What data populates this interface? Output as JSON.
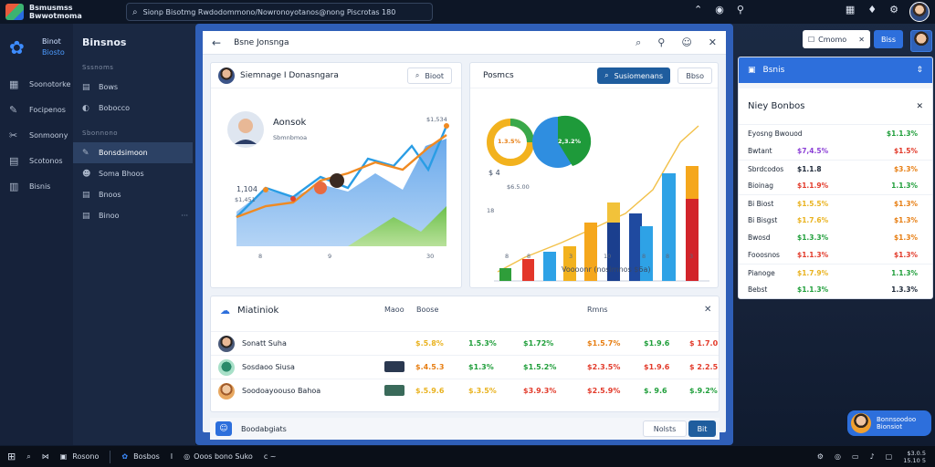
{
  "topbar": {
    "app_title_1": "Bsmusmss",
    "app_title_2": "Bwwotmoma",
    "search_text": "Sionp Bisotmg Rwdodommono/Nowronoyotanos@nong Piscrotas 180",
    "icons": [
      "trend-icon",
      "sync-icon",
      "person-search-icon",
      "grid-icon",
      "shield-icon",
      "settings-icon"
    ]
  },
  "sidebar": {
    "brand_line_1": "Binot",
    "brand_line_2": "Biosto",
    "items": [
      {
        "label": "Soonotorke",
        "icon": "grid-icon"
      },
      {
        "label": "Focipenos",
        "icon": "document-icon"
      },
      {
        "label": "Sonmoony",
        "icon": "tools-icon"
      },
      {
        "label": "Scotonos",
        "icon": "chart-icon"
      },
      {
        "label": "Bisnis",
        "icon": "list-icon"
      }
    ]
  },
  "subside": {
    "title": "Binsnos",
    "group_1": "Sssnoms",
    "group_2": "Sbonnono",
    "items_1": [
      {
        "label": "Bows",
        "icon": "bars-icon"
      },
      {
        "label": "Bobocco",
        "icon": "info-icon"
      }
    ],
    "items_2": [
      {
        "label": "Bonsdsimoon",
        "icon": "pencil-icon",
        "active": true
      },
      {
        "label": "Soma Bhoos",
        "icon": "user-icon"
      },
      {
        "label": "Bnoos",
        "icon": "bars-icon"
      },
      {
        "label": "Binoo",
        "icon": "bars-icon",
        "more": "···"
      }
    ]
  },
  "window": {
    "title": "Bsne Jonsnga",
    "card_a": {
      "title": "Siemnage I Donasngara",
      "button": "Bioot",
      "person_label": "Aonsok",
      "person_sub": "Sbmnbmoa",
      "stat_right": "$1,534",
      "stat_left_1": "1,104",
      "stat_left_2": "$1,451",
      "xticks": [
        "8",
        "9",
        "30"
      ]
    },
    "card_b": {
      "title": "Posmcs",
      "button_primary": "Susiomenans",
      "button_secondary": "Bbso",
      "donut_label": "1.3.5%",
      "pie_label": "2,3.2%",
      "value_left": "$ 4",
      "value_sub": "$6.5.00",
      "y_tick": "18",
      "xticks": [
        "8",
        "8",
        "3",
        "10",
        "8",
        "8",
        "3"
      ],
      "xlabel": "Voooonr (nosimnos $6a)"
    },
    "card_c": {
      "title": "Miatiniok",
      "col_1": "Maoo",
      "col_2": "Boose",
      "col_3": "Rmns",
      "rows": [
        {
          "name": "Sonatt Suha",
          "v1": "$.5.8%",
          "v2": "1.5.3%",
          "v3": "$1.72%",
          "v4": "$1.5.7%",
          "v5": "$1.9.6",
          "v6": "$ 1.7.0"
        },
        {
          "name": "Sosdaoo Siusa",
          "v1": "$.4.5.3",
          "v2": "$1.3%",
          "v3": "$1.5.2%",
          "v4": "$2.3.5%",
          "v5": "$1.9.6",
          "v6": "$ 2.2.5"
        },
        {
          "name": "Soodoayoouso Bahoa",
          "v1": "$.5.9.6",
          "v2": "$.3.5%",
          "v3": "$3.9.3%",
          "v4": "$2.5.9%",
          "v5": "$. 9.6",
          "v6": "$.9.2%"
        }
      ]
    },
    "footer": {
      "label": "Boodabgiats",
      "button_secondary": "Nolsts",
      "button_primary": "Bit"
    }
  },
  "topright": {
    "select": "Cmomo",
    "button": "Biss"
  },
  "rpanel": {
    "header": "Bsnis",
    "subtitle": "Niey Bonbos",
    "rows": [
      {
        "label": "Eyosng Bwouod",
        "v1": "",
        "v2": "$1.1.3%",
        "c2": "#1f9e3a"
      },
      {
        "label": "Bwtant",
        "v1": "$7,4.5%",
        "c1": "#8b3fd6",
        "v2": "$1.5%",
        "c2": "#e23a2a"
      },
      {
        "label": "Sbrdcodos",
        "v1": "$1.1.8",
        "c1": "#1b2636",
        "v2": "$3.3%",
        "c2": "#e77e12",
        "sep": true
      },
      {
        "label": "Bioinag",
        "v1": "$1.1.9%",
        "c1": "#e23a2a",
        "v2": "1.1.3%",
        "c2": "#1f9e3a"
      },
      {
        "label": "Bi Biost",
        "v1": "$1.5.5%",
        "c1": "#e9b21e",
        "v2": "$1.3%",
        "c2": "#e77e12",
        "sep": true
      },
      {
        "label": "Bi Bisgst",
        "v1": "$1.7.6%",
        "c1": "#e9b21e",
        "v2": "$1.3%",
        "c2": "#e77e12"
      },
      {
        "label": "Bwosd",
        "v1": "$1.3.3%",
        "c1": "#1f9e3a",
        "v2": "$1.3%",
        "c2": "#e77e12"
      },
      {
        "label": "Fooosnos",
        "v1": "$1.1.3%",
        "c1": "#e23a2a",
        "v2": "$1.3%",
        "c2": "#e23a2a"
      },
      {
        "label": "Pianoge",
        "v1": "$1.7.9%",
        "c1": "#e9b21e",
        "v2": "1.1.3%",
        "c2": "#1f9e3a",
        "sep": true
      },
      {
        "label": "Bebst",
        "v1": "$1.1.3%",
        "c1": "#1f9e3a",
        "v2": "1.3.3%",
        "c2": "#1b2636"
      }
    ]
  },
  "chat": {
    "line_1": "Bonnsoodoo",
    "line_2": "Bionsiot"
  },
  "taskbar": {
    "search_label": "Rosono",
    "app_1": "Bosbos",
    "app_2": "Ooos bono Suko",
    "app_3": "c ~",
    "clock_1": "$3.0.5",
    "clock_2": "15.10 5"
  },
  "colors": {
    "accent_blue": "#2d6fdc",
    "positive_green": "#1f9e3a",
    "negative_red": "#e23a2a",
    "warn_orange": "#e77e12",
    "yellow": "#e9b21e"
  }
}
